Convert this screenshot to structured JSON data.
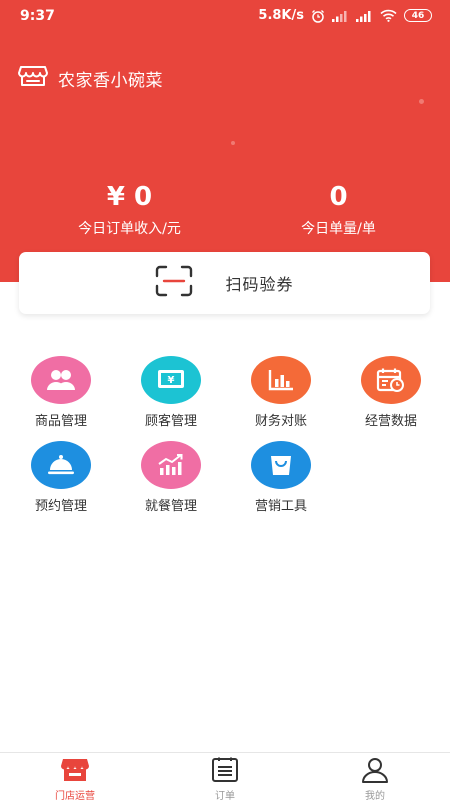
{
  "status_bar": {
    "time": "9:37",
    "speed": "5.8K/s",
    "battery": "46"
  },
  "store": {
    "name": "农家香小碗菜"
  },
  "stats": {
    "revenue_value": "¥ 0",
    "revenue_label": "今日订单收入/元",
    "orders_value": "0",
    "orders_label": "今日单量/单"
  },
  "scan": {
    "label": "扫码验券"
  },
  "grid": [
    {
      "label": "商品管理",
      "icon": "people-icon",
      "color": "#f06ea4"
    },
    {
      "label": "顾客管理",
      "icon": "money-card-icon",
      "color": "#1cc3d3"
    },
    {
      "label": "财务对账",
      "icon": "bar-chart-icon",
      "color": "#f46a38"
    },
    {
      "label": "经营数据",
      "icon": "calendar-clock-icon",
      "color": "#f4683a"
    },
    {
      "label": "预约管理",
      "icon": "food-cover-icon",
      "color": "#1e8fe0"
    },
    {
      "label": "就餐管理",
      "icon": "trend-chart-icon",
      "color": "#f06ea4"
    },
    {
      "label": "营销工具",
      "icon": "shopping-bag-icon",
      "color": "#1e8fe0"
    }
  ],
  "nav": {
    "store_ops": "门店运营",
    "orders": "订单",
    "mine": "我的"
  },
  "colors": {
    "brand": "#e8453c"
  }
}
